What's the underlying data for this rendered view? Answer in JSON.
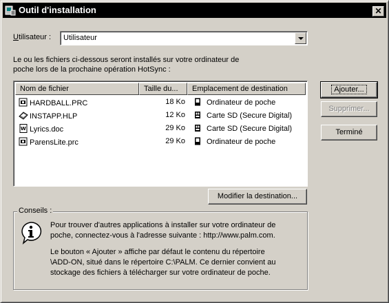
{
  "window": {
    "title": "Outil d'installation",
    "close_glyph": "✕"
  },
  "user": {
    "label": "Utilisateur :",
    "value": "Utilisateur"
  },
  "intro": {
    "line1": "Le ou les fichiers ci-dessous seront installés sur votre ordinateur de",
    "line2": "poche lors de la prochaine opération HotSync :"
  },
  "table": {
    "columns": [
      "Nom de fichier",
      "Taille du...",
      "Emplacement de destination"
    ],
    "rows": [
      {
        "name": "HARDBALL.PRC",
        "size": "18 Ko",
        "destination": "Ordinateur de poche",
        "file_icon": "prc-file-icon",
        "dest_icon": "handheld-icon"
      },
      {
        "name": "INSTAPP.HLP",
        "size": "12 Ko",
        "destination": "Carte SD (Secure Digital)",
        "file_icon": "help-file-icon",
        "dest_icon": "sd-card-icon"
      },
      {
        "name": "Lyrics.doc",
        "size": "29 Ko",
        "destination": "Carte SD (Secure Digital)",
        "file_icon": "doc-file-icon",
        "dest_icon": "sd-card-icon"
      },
      {
        "name": "ParensLite.prc",
        "size": "29 Ko",
        "destination": "Ordinateur de poche",
        "file_icon": "prc-file-icon",
        "dest_icon": "handheld-icon"
      }
    ]
  },
  "buttons": {
    "add": "Ajouter...",
    "remove": "Supprimer...",
    "done": "Terminé",
    "change_dest": "Modifier la destination..."
  },
  "tips": {
    "title": "Conseils :",
    "line1": "Pour trouver d'autres applications à installer sur votre ordinateur de",
    "line2": "poche, connectez-vous à l'adresse suivante : http://www.palm.com.",
    "line3": "Le bouton « Ajouter » affiche par défaut le contenu du répertoire",
    "line4": "\\ADD-ON, situé dans le répertoire C:\\PALM. Ce dernier convient au",
    "line5": "stockage des fichiers à télécharger sur votre ordinateur de poche."
  }
}
